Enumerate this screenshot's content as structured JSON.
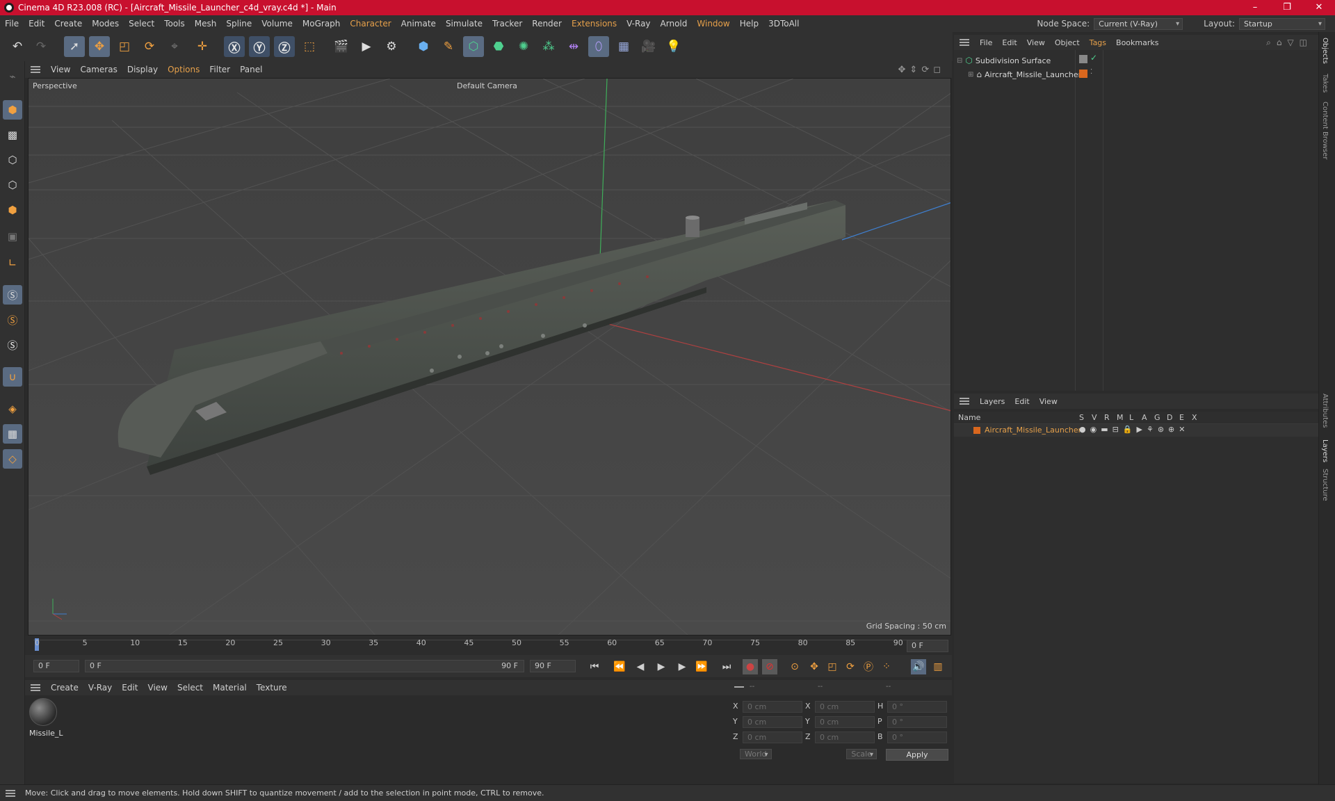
{
  "window": {
    "title": "Cinema 4D R23.008 (RC) - [Aircraft_Missile_Launcher_c4d_vray.c4d *] - Main",
    "min": "–",
    "max": "❐",
    "close": "✕"
  },
  "menubar": {
    "items": [
      "File",
      "Edit",
      "Create",
      "Modes",
      "Select",
      "Tools",
      "Mesh",
      "Spline",
      "Volume",
      "MoGraph",
      "Character",
      "Animate",
      "Simulate",
      "Tracker",
      "Render",
      "Extensions",
      "V-Ray",
      "Arnold",
      "Window",
      "Help",
      "3DToAll"
    ],
    "node_space_label": "Node Space:",
    "node_space_value": "Current (V-Ray)",
    "layout_label": "Layout:",
    "layout_value": "Startup"
  },
  "viewport": {
    "menu": [
      "View",
      "Cameras",
      "Display",
      "Options",
      "Filter",
      "Panel"
    ],
    "label": "Perspective",
    "camera": "Default Camera",
    "grid_spacing": "Grid Spacing : 50 cm"
  },
  "timeline": {
    "ticks": [
      "0",
      "5",
      "10",
      "15",
      "20",
      "25",
      "30",
      "35",
      "40",
      "45",
      "50",
      "55",
      "60",
      "65",
      "70",
      "75",
      "80",
      "85",
      "90"
    ],
    "current_frame_right": "0 F",
    "start_field": "0 F",
    "range_start": "0 F",
    "range_end": "90 F",
    "end_field": "90 F"
  },
  "materials": {
    "menu": [
      "Create",
      "V-Ray",
      "Edit",
      "View",
      "Select",
      "Material",
      "Texture"
    ],
    "items": [
      {
        "name": "Missile_L"
      }
    ]
  },
  "coords": {
    "headers": [
      "--",
      "--",
      "--"
    ],
    "rows": [
      {
        "a": "X",
        "av": "0 cm",
        "b": "X",
        "bv": "0 cm",
        "c": "H",
        "cv": "0 °"
      },
      {
        "a": "Y",
        "av": "0 cm",
        "b": "Y",
        "bv": "0 cm",
        "c": "P",
        "cv": "0 °"
      },
      {
        "a": "Z",
        "av": "0 cm",
        "b": "Z",
        "bv": "0 cm",
        "c": "B",
        "cv": "0 °"
      }
    ],
    "world": "World",
    "scale": "Scale",
    "apply": "Apply"
  },
  "objects": {
    "menu": [
      "File",
      "Edit",
      "View",
      "Object",
      "Tags",
      "Bookmarks"
    ],
    "tree": [
      {
        "name": "Subdivision Surface"
      },
      {
        "name": "Aircraft_Missile_Launcher"
      }
    ]
  },
  "layers": {
    "menu": [
      "Layers",
      "Edit",
      "View"
    ],
    "columns": [
      "Name",
      "S",
      "V",
      "R",
      "M",
      "L",
      "A",
      "G",
      "D",
      "E",
      "X"
    ],
    "rows": [
      {
        "name": "Aircraft_Missile_Launcher",
        "color": "#d9671e"
      }
    ]
  },
  "side_tabs": [
    "Objects",
    "Takes",
    "Content Browser",
    "Attributes",
    "Layers",
    "Structure"
  ],
  "status": "Move: Click and drag to move elements. Hold down SHIFT to quantize movement / add to the selection in point mode, CTRL to remove.",
  "colors": {
    "accent": "#e6a04a",
    "title_bar": "#c8102e",
    "selection": "#5a6b82",
    "layer_orange": "#d9671e"
  }
}
